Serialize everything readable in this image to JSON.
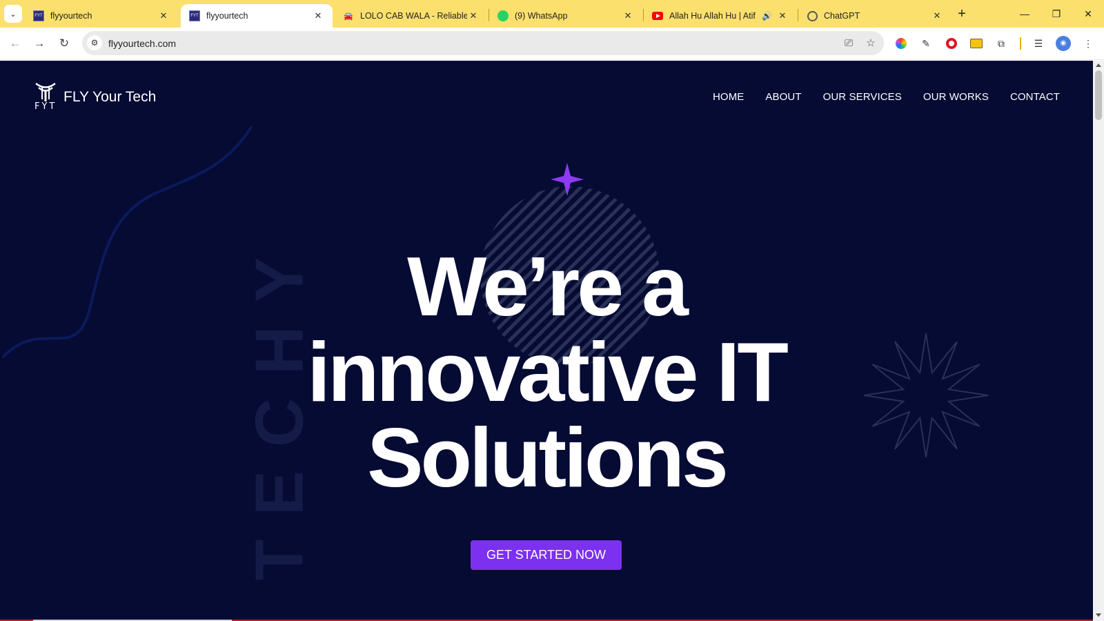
{
  "browser": {
    "tabs": [
      {
        "title": "flyyourtech",
        "favicon": "fyt-logo-icon",
        "active": false
      },
      {
        "title": "flyyourtech",
        "favicon": "fyt-logo-icon",
        "active": true
      },
      {
        "title": "LOLO CAB WALA - Reliable T",
        "favicon": "car-icon",
        "active": false
      },
      {
        "title": "(9) WhatsApp",
        "favicon": "whatsapp-icon",
        "active": false
      },
      {
        "title": "Allah Hu Allah Hu | Atif A",
        "favicon": "youtube-icon",
        "active": false,
        "audio": true
      },
      {
        "title": "ChatGPT",
        "favicon": "chatgpt-icon",
        "active": false
      }
    ],
    "url": "flyyourtech.com",
    "tab_strip_color": "#fbe06d"
  },
  "site": {
    "logo_text": "FLY Your Tech",
    "logo_mark_text": "FYT",
    "nav": [
      "HOME",
      "ABOUT",
      "OUR SERVICES",
      "OUR WORKS",
      "CONTACT"
    ],
    "watermark": "TECHY",
    "hero_lines": [
      "We’re a",
      "innovative IT",
      "Solutions"
    ],
    "cta_label": "GET STARTED NOW",
    "colors": {
      "background": "#050b33",
      "accent": "#7b31ef",
      "text": "#ffffff"
    }
  }
}
